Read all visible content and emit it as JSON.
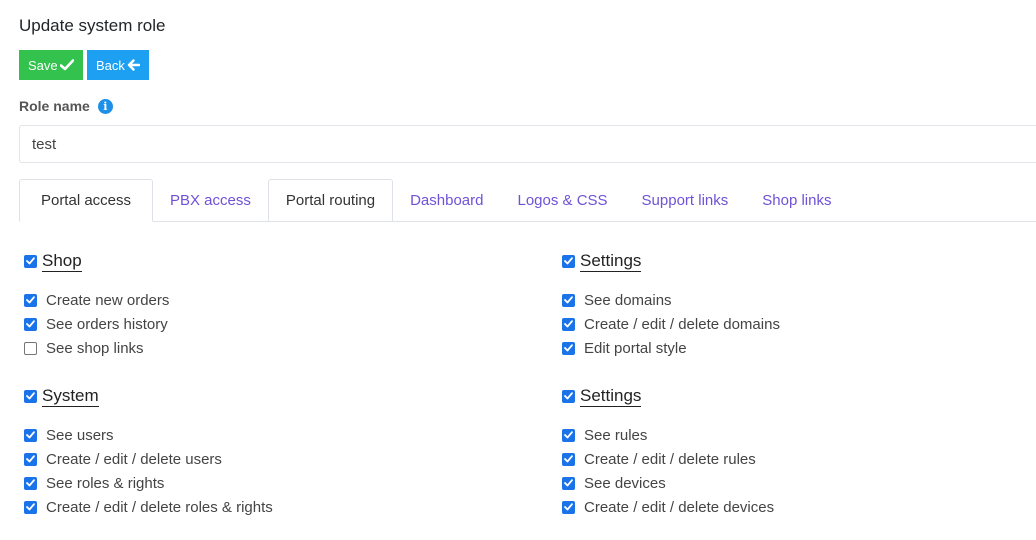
{
  "page": {
    "title": "Update system role"
  },
  "toolbar": {
    "save_label": "Save",
    "back_label": "Back"
  },
  "role": {
    "label": "Role name",
    "value": "test"
  },
  "tabs": [
    {
      "label": "Portal access"
    },
    {
      "label": "PBX access"
    },
    {
      "label": "Portal routing"
    },
    {
      "label": "Dashboard"
    },
    {
      "label": "Logos & CSS"
    },
    {
      "label": "Support links"
    },
    {
      "label": "Shop links"
    }
  ],
  "groups": [
    {
      "title": "Shop",
      "checked": true,
      "items": [
        {
          "label": "Create new orders",
          "checked": true
        },
        {
          "label": "See orders history",
          "checked": true
        },
        {
          "label": "See shop links",
          "checked": false
        }
      ]
    },
    {
      "title": "Settings",
      "checked": true,
      "items": [
        {
          "label": "See domains",
          "checked": true
        },
        {
          "label": "Create / edit / delete domains",
          "checked": true
        },
        {
          "label": "Edit portal style",
          "checked": true
        }
      ]
    },
    {
      "title": "System",
      "checked": true,
      "items": [
        {
          "label": "See users",
          "checked": true
        },
        {
          "label": "Create / edit / delete users",
          "checked": true
        },
        {
          "label": "See roles & rights",
          "checked": true
        },
        {
          "label": "Create / edit / delete roles & rights",
          "checked": true
        }
      ]
    },
    {
      "title": "Settings",
      "checked": true,
      "items": [
        {
          "label": "See rules",
          "checked": true
        },
        {
          "label": "Create / edit / delete rules",
          "checked": true
        },
        {
          "label": "See devices",
          "checked": true
        },
        {
          "label": "Create / edit / delete devices",
          "checked": true
        }
      ]
    }
  ],
  "colors": {
    "save": "#32c24d",
    "back": "#1ea0f2",
    "tab_link": "#6f52d6",
    "checkbox": "#1a73e8"
  }
}
